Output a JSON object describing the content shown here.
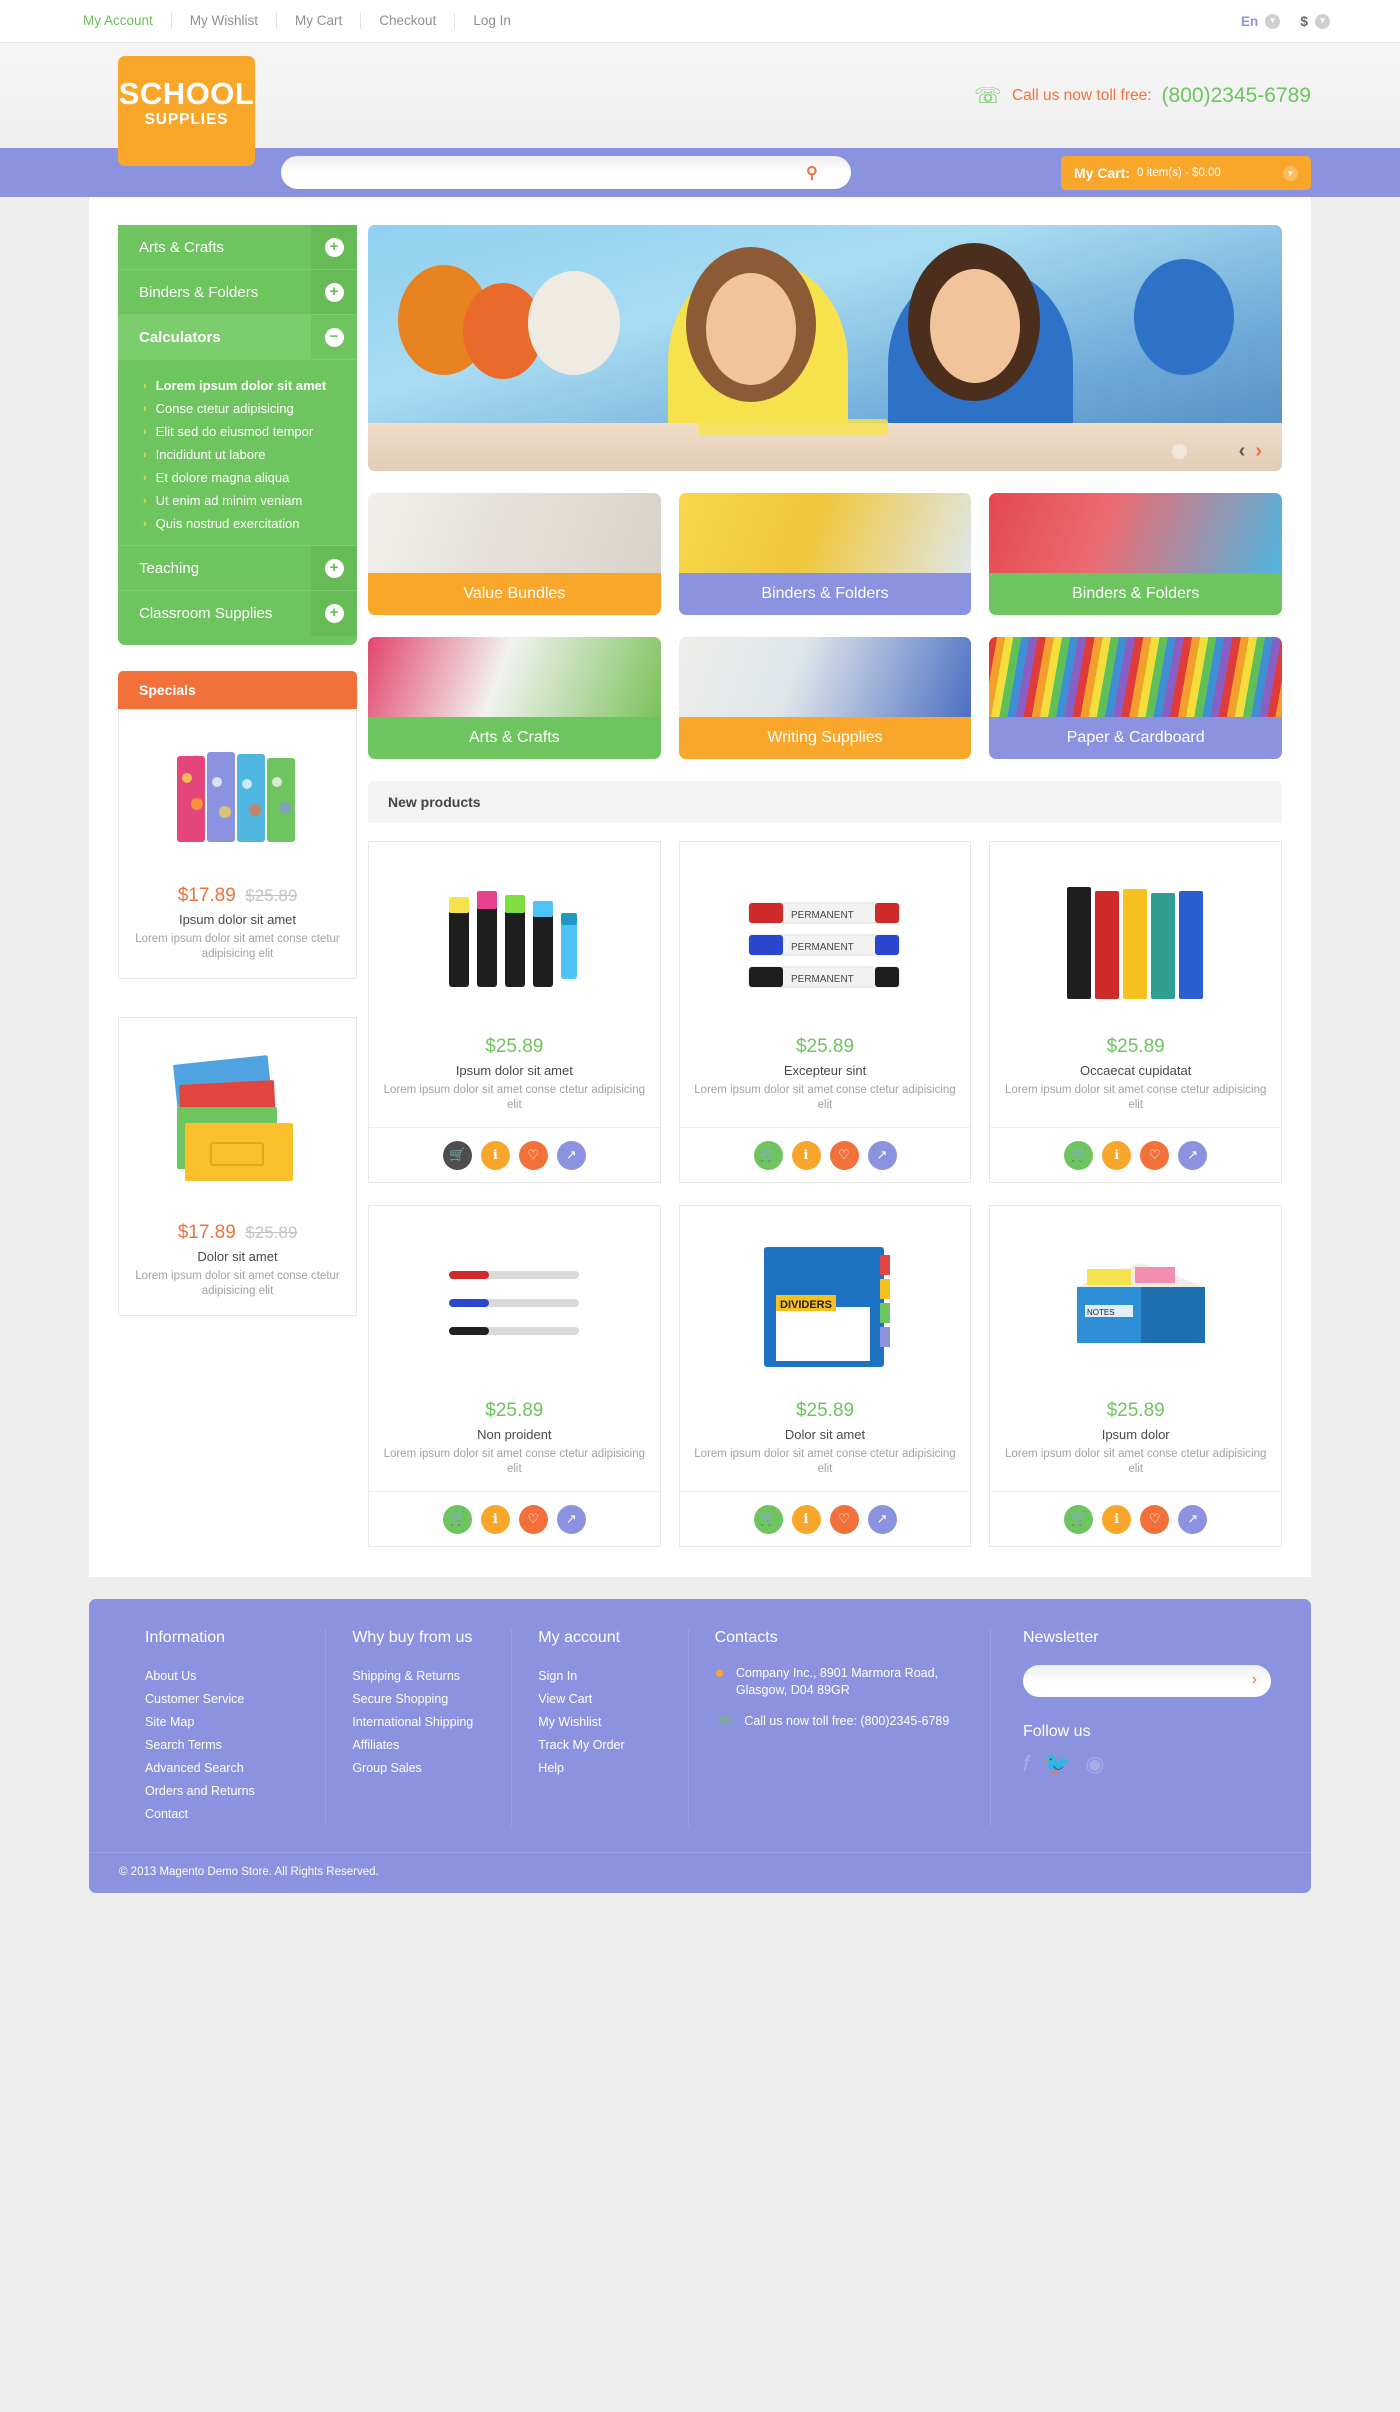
{
  "topbar": {
    "links": [
      "My Account",
      "My Wishlist",
      "My Cart",
      "Checkout",
      "Log In"
    ],
    "language": "En",
    "currency": "$",
    "chevron_icon": "chevron-down-icon"
  },
  "header": {
    "logo_line1": "SCHOOL",
    "logo_line2": "SUPPLIES",
    "phone_label": "Call us now toll free:",
    "phone_number": "(800)2345-6789",
    "phone_icon": "phone-icon"
  },
  "search": {
    "value": "",
    "placeholder": "",
    "button_icon": "search-icon"
  },
  "cart": {
    "title": "My Cart:",
    "summary": "0 item(s) - $0.00",
    "chevron_icon": "chevron-down-icon"
  },
  "sidebar": {
    "nav": [
      {
        "label": "Arts & Crafts",
        "state": "collapsed",
        "sign": "+"
      },
      {
        "label": "Binders & Folders",
        "state": "collapsed",
        "sign": "+"
      },
      {
        "label": "Calculators",
        "state": "expanded",
        "sign": "−"
      },
      {
        "label": "Teaching",
        "state": "collapsed",
        "sign": "+"
      },
      {
        "label": "Classroom Supplies",
        "state": "collapsed",
        "sign": "+"
      }
    ],
    "sub_items": [
      "Lorem ipsum dolor sit amet",
      "Conse ctetur adipisicing",
      "Elit sed do eiusmod tempor",
      "Incididunt ut labore",
      "Et dolore magna aliqua",
      "Ut enim ad minim veniam",
      "Quis nostrud exercitation"
    ],
    "specials_title": "Specials",
    "specials_product": {
      "price_special": "$17.89",
      "price_old": "$25.89",
      "name": "Ipsum dolor sit amet",
      "desc": "Lorem ipsum dolor sit amet conse ctetur adipisicing elit"
    },
    "featured_product": {
      "price_special": "$17.89",
      "price_old": "$25.89",
      "name": "Dolor sit amet",
      "desc": "Lorem ipsum dolor sit amet conse ctetur adipisicing elit"
    }
  },
  "hero": {
    "prev_icon": "chevron-left-icon",
    "next_icon": "chevron-right-icon",
    "prev": "‹",
    "next": "›"
  },
  "tiles": [
    {
      "label": "Value Bundles",
      "color": "#f9a72b",
      "img": "img-notebooks"
    },
    {
      "label": "Binders & Folders",
      "color": "#8b93e0",
      "img": "img-folders"
    },
    {
      "label": "Binders & Folders",
      "color": "#6ec45e",
      "img": "img-binders"
    },
    {
      "label": "Arts & Crafts",
      "color": "#6ec45e",
      "img": "img-arts"
    },
    {
      "label": "Writing Supplies",
      "color": "#f9a72b",
      "img": "img-writing"
    },
    {
      "label": "Paper & Cardboard",
      "color": "#8b93e0",
      "img": "img-paper"
    }
  ],
  "new_products": {
    "title": "New products",
    "action_icons": [
      "cart-icon",
      "info-icon",
      "heart-icon",
      "compare-icon"
    ],
    "row1": [
      {
        "price": "$25.89",
        "name": "Ipsum dolor sit amet",
        "desc": "Lorem ipsum dolor sit amet conse ctetur adipisicing elit",
        "cart_dark": true
      },
      {
        "price": "$25.89",
        "name": "Excepteur sint",
        "desc": "Lorem ipsum dolor sit amet conse ctetur adipisicing elit",
        "cart_dark": false
      },
      {
        "price": "$25.89",
        "name": "Occaecat cupidatat",
        "desc": "Lorem ipsum dolor sit amet conse ctetur adipisicing elit",
        "cart_dark": false
      }
    ],
    "row2": [
      {
        "price": "$25.89",
        "name": "Non proident",
        "desc": "Lorem ipsum dolor sit amet conse ctetur adipisicing elit",
        "cart_dark": false
      },
      {
        "price": "$25.89",
        "name": "Dolor sit amet",
        "desc": "Lorem ipsum dolor sit amet conse ctetur adipisicing elit",
        "cart_dark": false
      },
      {
        "price": "$25.89",
        "name": "Ipsum dolor",
        "desc": "Lorem ipsum dolor sit amet conse ctetur adipisicing elit",
        "cart_dark": false
      }
    ]
  },
  "footer": {
    "col1": {
      "title": "Information",
      "links": [
        "About Us",
        "Customer Service",
        "Site Map",
        "Search Terms",
        "Advanced Search",
        "Orders and Returns",
        "Contact"
      ]
    },
    "col2": {
      "title": "Why buy from us",
      "links": [
        "Shipping & Returns",
        "Secure Shopping",
        "International Shipping",
        "Affiliates",
        "Group Sales"
      ]
    },
    "col3": {
      "title": "My account",
      "links": [
        "Sign In",
        "View Cart",
        "My Wishlist",
        "Track My Order",
        "Help"
      ]
    },
    "col4": {
      "title": "Contacts",
      "address": "Company Inc., 8901 Marmora Road, Glasgow, D04 89GR",
      "phone": "Call us now toll free: (800)2345-6789",
      "pin_icon": "map-pin-icon",
      "phone_icon": "phone-icon"
    },
    "col5": {
      "title": "Newsletter",
      "input_value": "",
      "input_placeholder": "",
      "submit_icon": "chevron-right-icon",
      "follow_title": "Follow us",
      "socials": [
        "facebook-icon",
        "twitter-icon",
        "rss-icon"
      ]
    },
    "copyright": "© 2013 Magento Demo Store. All Rights Reserved."
  }
}
